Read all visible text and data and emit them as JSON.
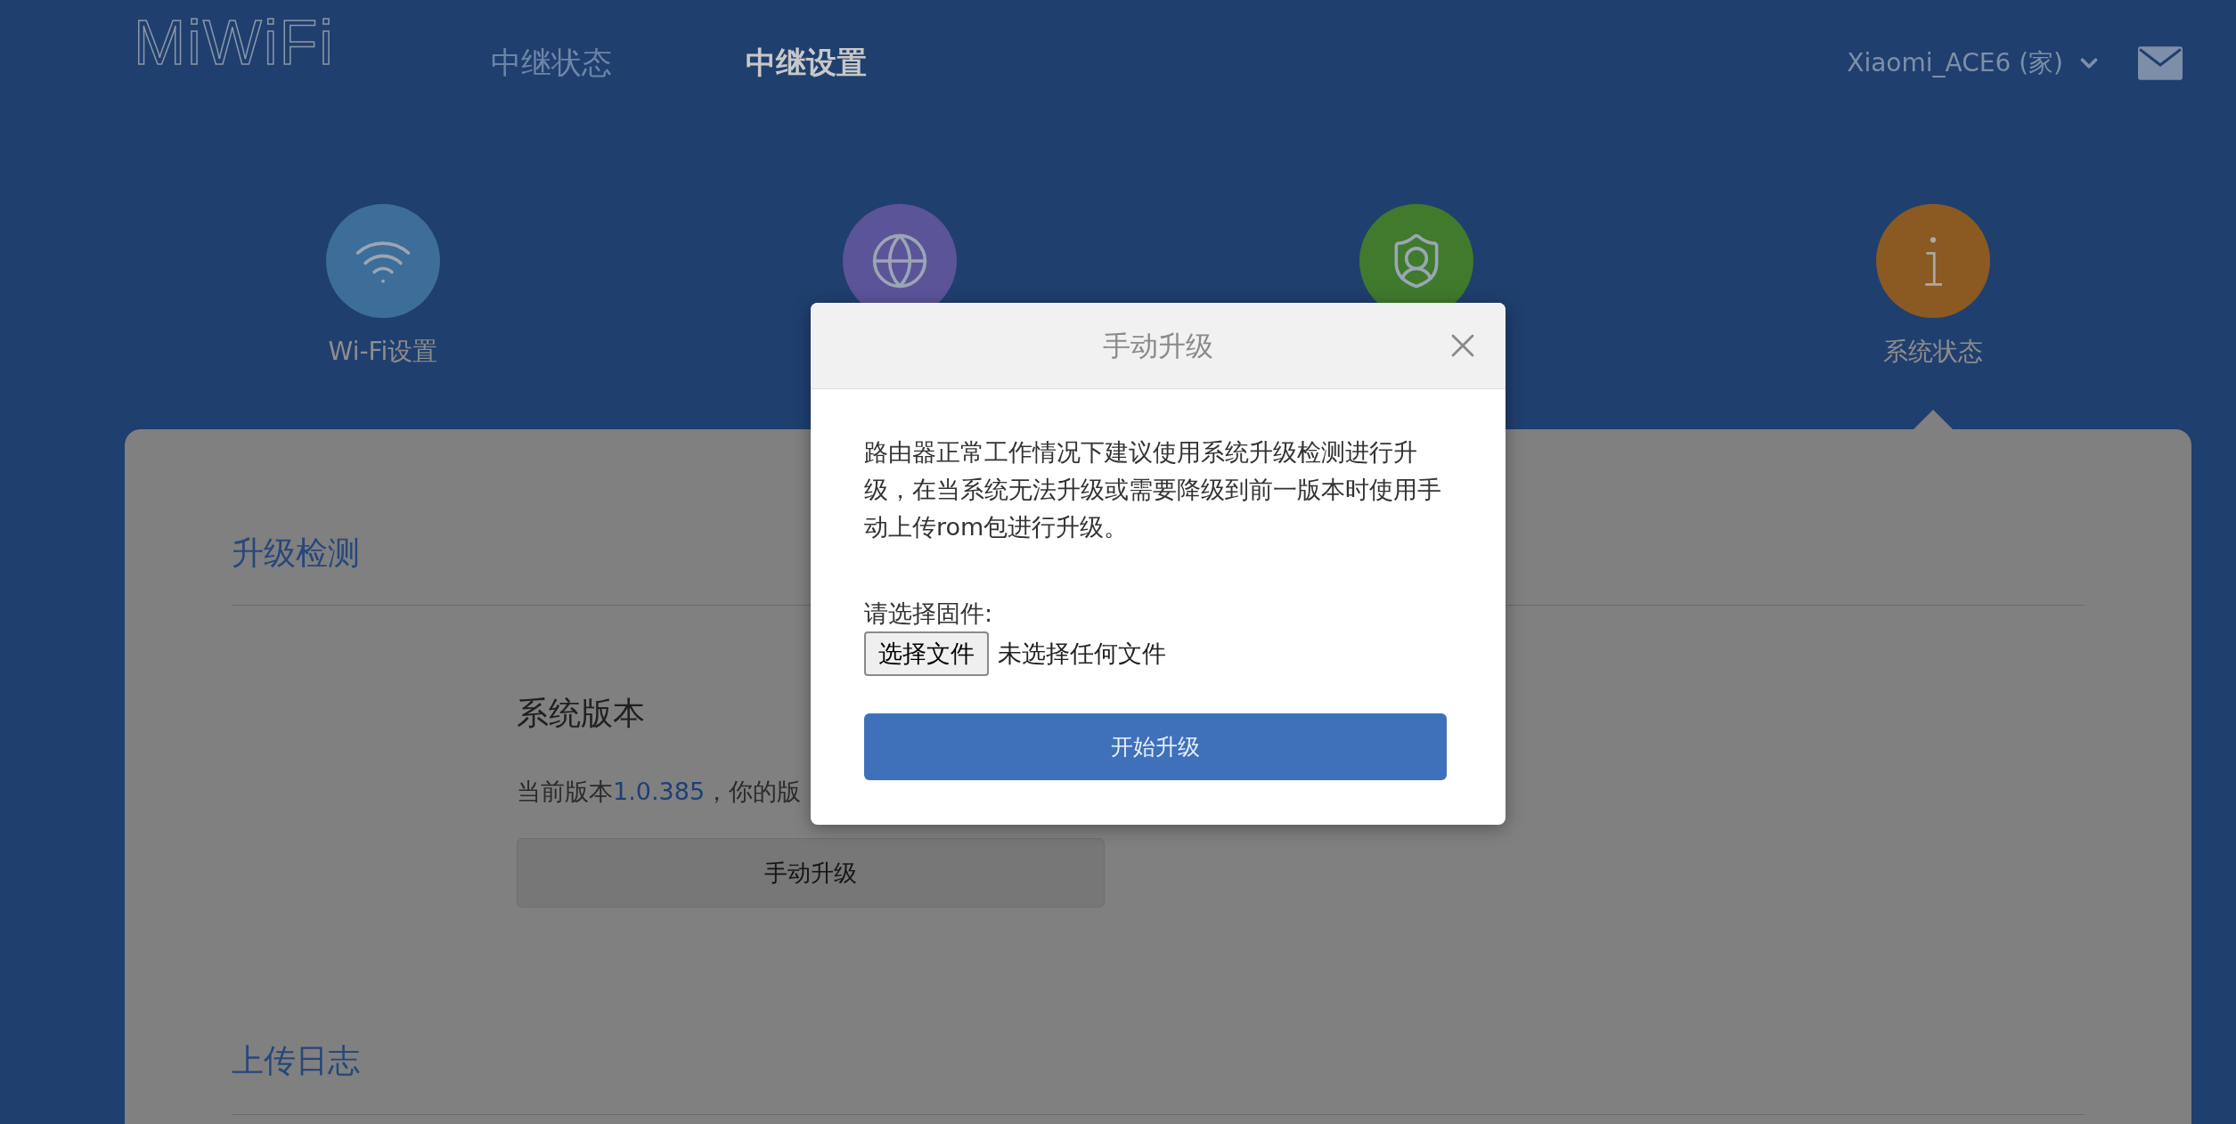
{
  "header": {
    "logo": "MiWiFi",
    "nav": [
      {
        "label": "中继状态",
        "selected": false
      },
      {
        "label": "中继设置",
        "selected": true
      }
    ],
    "account": "Xiaomi_ACE6 (家)"
  },
  "features": [
    {
      "kind": "wifi",
      "label": "Wi-Fi设置",
      "color": "#3d6d99",
      "selected": false
    },
    {
      "kind": "globe",
      "color": "#5b5499"
    },
    {
      "kind": "shield",
      "color": "#3f7a2d"
    },
    {
      "kind": "info",
      "label": "系统状态",
      "color": "#8a5a22",
      "selected": true
    }
  ],
  "upgrade_check": {
    "title": "升级检测",
    "version_title": "系统版本",
    "version_prefix": "当前版本",
    "version": "1.0.385",
    "version_suffix": "，你的版",
    "button": "手动升级"
  },
  "upload_log": {
    "title": "上传日志"
  },
  "dialog": {
    "title": "手动升级",
    "message": "路由器正常工作情况下建议使用系统升级检测进行升级，在当系统无法升级或需要降级到前一版本时使用手动上传rom包进行升级。",
    "file_label": "请选择固件:",
    "file_button": "选择文件",
    "file_status": "未选择任何文件",
    "submit": "开始升级"
  }
}
